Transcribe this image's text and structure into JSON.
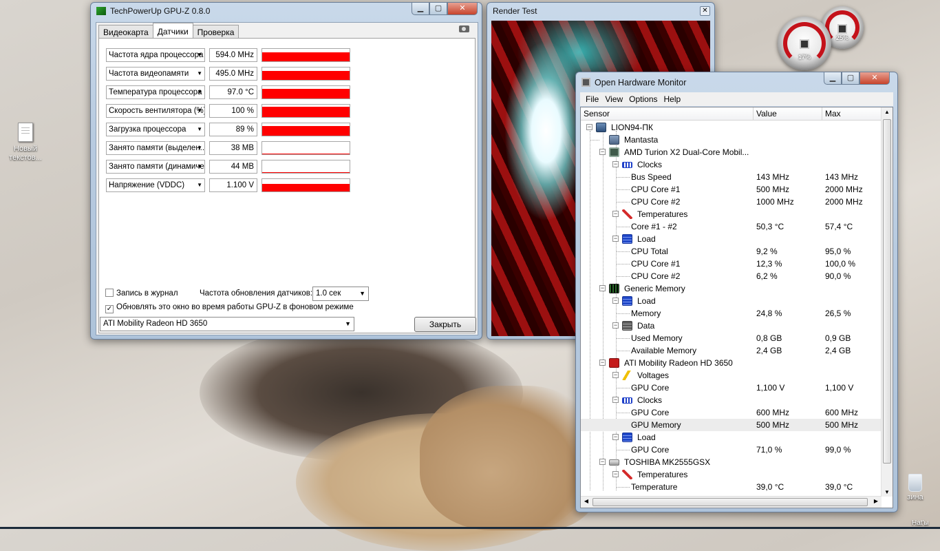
{
  "desktop": {
    "icon_label": "Новый текстов...",
    "recycle_label": "зина",
    "corner_text": "Hat'ы"
  },
  "gadgets": [
    {
      "pct": "17%"
    },
    {
      "pct": "25%"
    }
  ],
  "gpuz": {
    "title": "TechPowerUp GPU-Z 0.8.0",
    "tabs": [
      "Видеокарта",
      "Датчики",
      "Проверка"
    ],
    "active_tab": "Датчики",
    "sensors": [
      {
        "name": "Частота ядра процессора",
        "value": "594.0 MHz",
        "fill": 0.75
      },
      {
        "name": "Частота видеопамяти",
        "value": "495.0 MHz",
        "fill": 0.75
      },
      {
        "name": "Температура процессора",
        "value": "97.0 °C",
        "fill": 0.8
      },
      {
        "name": "Скорость вентилятора (%)",
        "value": "100 %",
        "fill": 0.85
      },
      {
        "name": "Загрузка процессора",
        "value": "89 %",
        "fill": 0.8
      },
      {
        "name": "Занято памяти (выделен...",
        "value": "38 MB",
        "fill": 0.05
      },
      {
        "name": "Занято памяти (динамиче...",
        "value": "44 MB",
        "fill": 0.06
      },
      {
        "name": "Напряжение (VDDC)",
        "value": "1.100 V",
        "fill": 0.6
      }
    ],
    "log_label": "Запись в журнал",
    "refresh_label": "Частота обновления датчиков:",
    "refresh_value": "1.0 сек",
    "background_label": "Обновлять это окно во время работы GPU-Z в фоновом режиме",
    "gpu_select": "ATI Mobility Radeon HD 3650",
    "close_button": "Закрыть"
  },
  "render": {
    "title": "Render Test"
  },
  "ohm": {
    "title": "Open Hardware Monitor",
    "menu": [
      "File",
      "View",
      "Options",
      "Help"
    ],
    "columns": {
      "sensor": "Sensor",
      "value": "Value",
      "max": "Max"
    },
    "rows": [
      {
        "level": 0,
        "exp": "−",
        "icon": "pc",
        "label": "LION94-ПК",
        "value": "",
        "max": ""
      },
      {
        "level": 1,
        "exp": "",
        "icon": "mb",
        "label": "Mantasta",
        "value": "",
        "max": ""
      },
      {
        "level": 1,
        "exp": "−",
        "icon": "cpu",
        "label": "AMD Turion X2 Dual-Core Mobil...",
        "value": "",
        "max": ""
      },
      {
        "level": 2,
        "exp": "−",
        "icon": "clock",
        "label": "Clocks",
        "value": "",
        "max": ""
      },
      {
        "level": 3,
        "exp": "",
        "icon": "",
        "label": "Bus Speed",
        "value": "143 MHz",
        "max": "143 MHz"
      },
      {
        "level": 3,
        "exp": "",
        "icon": "",
        "label": "CPU Core #1",
        "value": "500 MHz",
        "max": "2000 MHz"
      },
      {
        "level": 3,
        "exp": "",
        "icon": "",
        "label": "CPU Core #2",
        "value": "1000 MHz",
        "max": "2000 MHz"
      },
      {
        "level": 2,
        "exp": "−",
        "icon": "temp",
        "label": "Temperatures",
        "value": "",
        "max": ""
      },
      {
        "level": 3,
        "exp": "",
        "icon": "",
        "label": "Core #1 - #2",
        "value": "50,3 °C",
        "max": "57,4 °C"
      },
      {
        "level": 2,
        "exp": "−",
        "icon": "load",
        "label": "Load",
        "value": "",
        "max": ""
      },
      {
        "level": 3,
        "exp": "",
        "icon": "",
        "label": "CPU Total",
        "value": "9,2 %",
        "max": "95,0 %"
      },
      {
        "level": 3,
        "exp": "",
        "icon": "",
        "label": "CPU Core #1",
        "value": "12,3 %",
        "max": "100,0 %"
      },
      {
        "level": 3,
        "exp": "",
        "icon": "",
        "label": "CPU Core #2",
        "value": "6,2 %",
        "max": "90,0 %"
      },
      {
        "level": 1,
        "exp": "−",
        "icon": "mem",
        "label": "Generic Memory",
        "value": "",
        "max": ""
      },
      {
        "level": 2,
        "exp": "−",
        "icon": "load",
        "label": "Load",
        "value": "",
        "max": ""
      },
      {
        "level": 3,
        "exp": "",
        "icon": "",
        "label": "Memory",
        "value": "24,8 %",
        "max": "26,5 %"
      },
      {
        "level": 2,
        "exp": "−",
        "icon": "data",
        "label": "Data",
        "value": "",
        "max": ""
      },
      {
        "level": 3,
        "exp": "",
        "icon": "",
        "label": "Used Memory",
        "value": "0,8 GB",
        "max": "0,9 GB"
      },
      {
        "level": 3,
        "exp": "",
        "icon": "",
        "label": "Available Memory",
        "value": "2,4 GB",
        "max": "2,4 GB"
      },
      {
        "level": 1,
        "exp": "−",
        "icon": "ati",
        "label": "ATI Mobility Radeon HD 3650",
        "value": "",
        "max": ""
      },
      {
        "level": 2,
        "exp": "−",
        "icon": "volt",
        "label": "Voltages",
        "value": "",
        "max": ""
      },
      {
        "level": 3,
        "exp": "",
        "icon": "",
        "label": "GPU Core",
        "value": "1,100 V",
        "max": "1,100 V"
      },
      {
        "level": 2,
        "exp": "−",
        "icon": "clock",
        "label": "Clocks",
        "value": "",
        "max": ""
      },
      {
        "level": 3,
        "exp": "",
        "icon": "",
        "label": "GPU Core",
        "value": "600 MHz",
        "max": "600 MHz"
      },
      {
        "level": 3,
        "exp": "",
        "icon": "",
        "label": "GPU Memory",
        "value": "500 MHz",
        "max": "500 MHz",
        "selected": true
      },
      {
        "level": 2,
        "exp": "−",
        "icon": "load",
        "label": "Load",
        "value": "",
        "max": ""
      },
      {
        "level": 3,
        "exp": "",
        "icon": "",
        "label": "GPU Core",
        "value": "71,0 %",
        "max": "99,0 %"
      },
      {
        "level": 1,
        "exp": "−",
        "icon": "hdd",
        "label": "TOSHIBA MK2555GSX",
        "value": "",
        "max": ""
      },
      {
        "level": 2,
        "exp": "−",
        "icon": "temp",
        "label": "Temperatures",
        "value": "",
        "max": ""
      },
      {
        "level": 3,
        "exp": "",
        "icon": "",
        "label": "Temperature",
        "value": "39,0 °C",
        "max": "39,0 °C"
      }
    ]
  }
}
